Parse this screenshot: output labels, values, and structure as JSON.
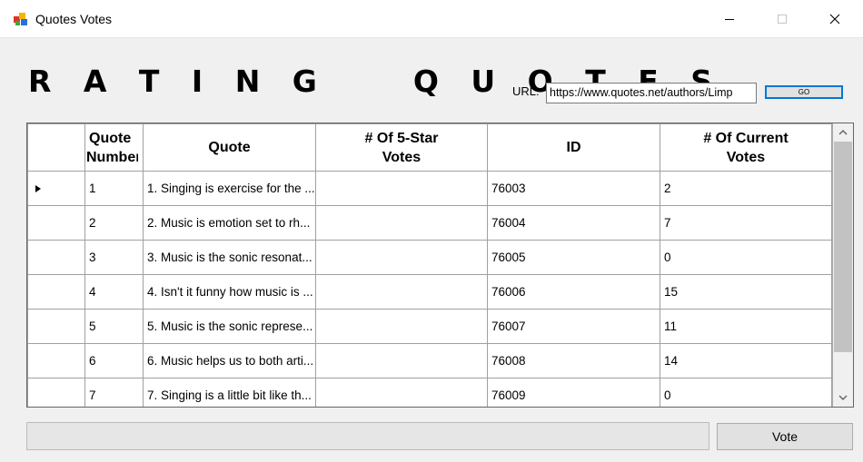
{
  "window": {
    "title": "Quotes Votes",
    "icons": [
      "app-icon",
      "minimize-icon",
      "maximize-icon",
      "close-icon"
    ]
  },
  "heading": "R A T I N G    Q U O T E S",
  "url": {
    "label": "URL:",
    "value": "https://www.quotes.net/authors/Limp"
  },
  "go_label": "GO",
  "grid": {
    "columns": [
      {
        "line1": "Quote",
        "line2": "Number"
      },
      {
        "line1": "Quote",
        "line2": ""
      },
      {
        "line1": "# Of 5-Star",
        "line2": "Votes"
      },
      {
        "line1": "ID",
        "line2": ""
      },
      {
        "line1": "# Of Current",
        "line2": "Votes"
      }
    ],
    "rows": [
      {
        "number": "1",
        "quote": "1. Singing is exercise for the ...",
        "five_star": "",
        "id": "76003",
        "current": "2",
        "current_row": true
      },
      {
        "number": "2",
        "quote": "2. Music is emotion set to rh...",
        "five_star": "",
        "id": "76004",
        "current": "7",
        "current_row": false
      },
      {
        "number": "3",
        "quote": "3. Music is the sonic resonat...",
        "five_star": "",
        "id": "76005",
        "current": "0",
        "current_row": false
      },
      {
        "number": "4",
        "quote": "4. Isn't it funny how music is ...",
        "five_star": "",
        "id": "76006",
        "current": "15",
        "current_row": false
      },
      {
        "number": "5",
        "quote": "5. Music is the sonic represe...",
        "five_star": "",
        "id": "76007",
        "current": "11",
        "current_row": false
      },
      {
        "number": "6",
        "quote": "6. Music helps us to both arti...",
        "five_star": "",
        "id": "76008",
        "current": "14",
        "current_row": false
      },
      {
        "number": "7",
        "quote": "7. Singing is a little bit like th...",
        "five_star": "",
        "id": "76009",
        "current": "0",
        "current_row": false
      }
    ]
  },
  "progress": 0,
  "vote_label": "Vote",
  "colors": {
    "accent": "#0078d7",
    "background": "#f0f0f0",
    "grid_line": "#a0a0a0"
  }
}
